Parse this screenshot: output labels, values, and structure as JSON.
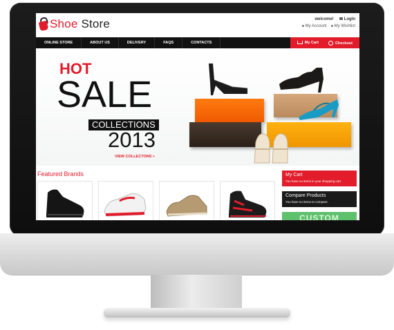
{
  "logo": {
    "text_main": "Shoe",
    "text_rest": " Store"
  },
  "header": {
    "welcome": "welcome!",
    "login": "Login",
    "my_account": "My Account",
    "my_wishlist": "My Wishlist"
  },
  "nav": {
    "items": [
      "ONLINE STORE",
      "ABOUT US",
      "DELIVERY",
      "FAQS",
      "CONTACTS"
    ],
    "cart": "My Cart",
    "checkout": "Checkout"
  },
  "banner": {
    "hot": "HOT",
    "sale": "SALE",
    "collections": "COLLECTIONS",
    "year": "2013",
    "view_link": "VIEW COLLECTONS »"
  },
  "featured": {
    "title": "Featured Brands"
  },
  "sidebar": {
    "cart_title": "My Cart",
    "cart_text": "You have no items in your shopping cart.",
    "compare_title": "Compare Products",
    "compare_text": "You have no items to compare.",
    "promo_text": "CUSTOM"
  },
  "colors": {
    "accent": "#e21c2b",
    "nav_bg": "#121212",
    "bezel": "#111111"
  },
  "icons": [
    "shopping-bag-logo-icon",
    "lock-icon",
    "cart-icon",
    "checkout-icon"
  ]
}
